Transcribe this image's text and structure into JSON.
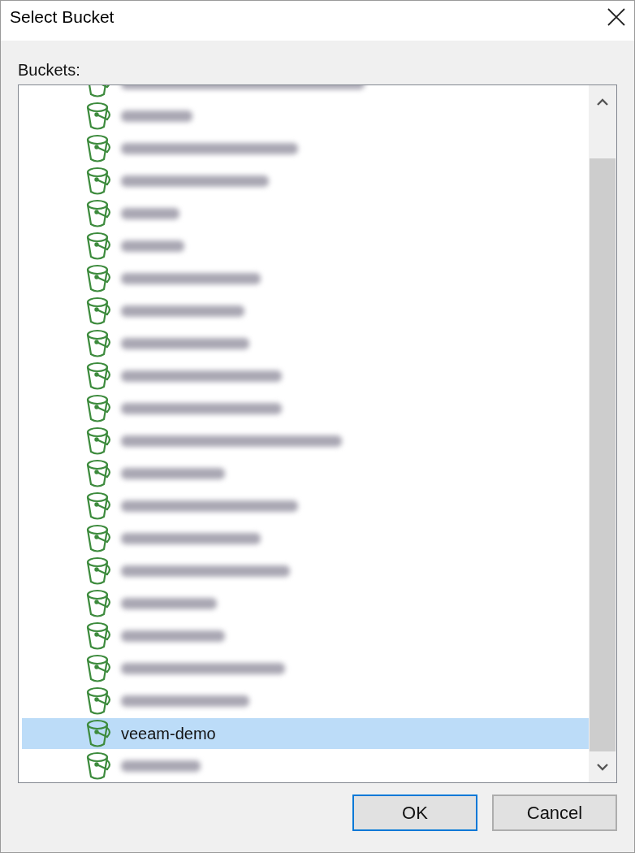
{
  "window": {
    "title": "Select Bucket"
  },
  "list": {
    "label": "Buckets:",
    "items": [
      {
        "kind": "blurred",
        "selected": false
      },
      {
        "kind": "blurred",
        "selected": false
      },
      {
        "kind": "blurred",
        "selected": false
      },
      {
        "kind": "blurred",
        "selected": false
      },
      {
        "kind": "blurred",
        "selected": false
      },
      {
        "kind": "blurred",
        "selected": false
      },
      {
        "kind": "blurred",
        "selected": false
      },
      {
        "kind": "blurred",
        "selected": false
      },
      {
        "kind": "blurred",
        "selected": false
      },
      {
        "kind": "blurred",
        "selected": false
      },
      {
        "kind": "blurred",
        "selected": false
      },
      {
        "kind": "blurred",
        "selected": false
      },
      {
        "kind": "blurred",
        "selected": false
      },
      {
        "kind": "blurred",
        "selected": false
      },
      {
        "kind": "blurred",
        "selected": false
      },
      {
        "kind": "blurred",
        "selected": false
      },
      {
        "kind": "blurred",
        "selected": false
      },
      {
        "kind": "blurred",
        "selected": false
      },
      {
        "kind": "blurred",
        "selected": false
      },
      {
        "kind": "blurred",
        "selected": false
      },
      {
        "kind": "named",
        "name": "veeam-demo",
        "selected": true
      },
      {
        "kind": "blurred",
        "selected": false
      }
    ]
  },
  "buttons": [
    {
      "label": "OK",
      "default": true
    },
    {
      "label": "Cancel",
      "default": false
    }
  ]
}
